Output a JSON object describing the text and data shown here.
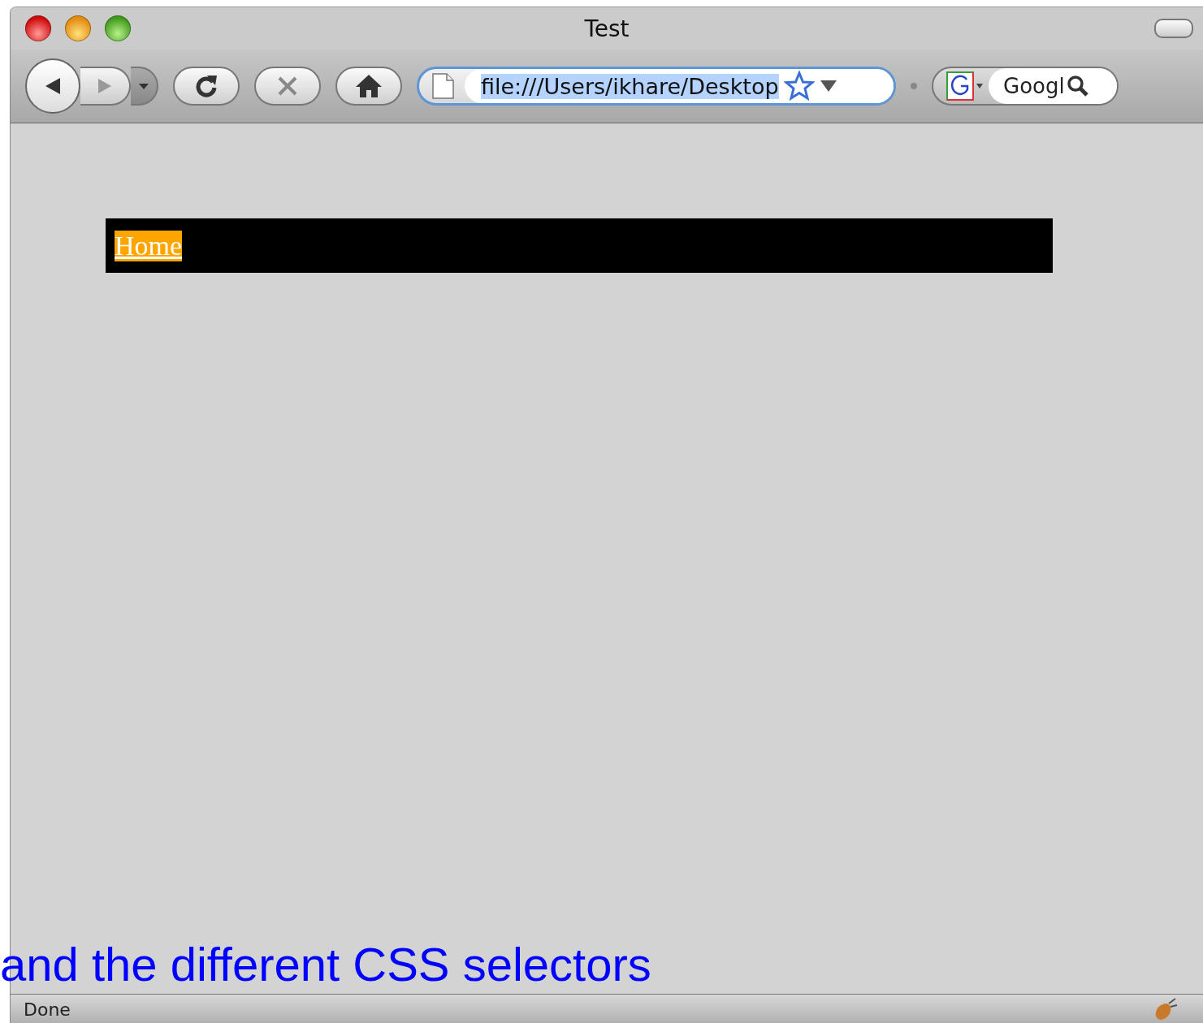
{
  "window": {
    "title": "Test"
  },
  "toolbar": {
    "url": "file:///Users/ikhare/Desktop",
    "url_selected": true,
    "search_value": "Googl"
  },
  "page": {
    "nav_links": [
      {
        "label": "Home"
      }
    ]
  },
  "status_bar": {
    "text": "Done"
  },
  "overlay_text": "and the different CSS selectors"
}
